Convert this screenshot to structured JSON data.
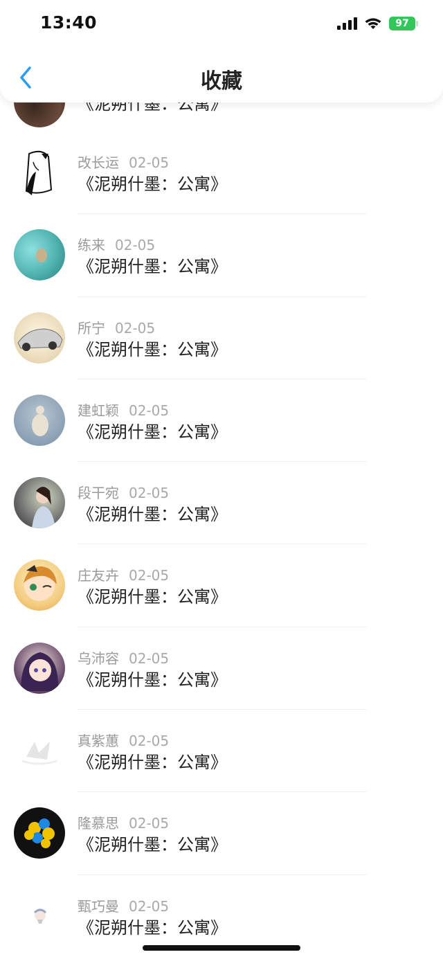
{
  "status": {
    "time": "13:40",
    "battery": "97"
  },
  "header": {
    "title": "收藏"
  },
  "items": [
    {
      "name": "",
      "date": "",
      "book": "《泥朔什墨：公寓》",
      "avatar_color": "#6b4a3a"
    },
    {
      "name": "改长运",
      "date": "02-05",
      "book": "《泥朔什墨：公寓》",
      "avatar_color": "#ffffff"
    },
    {
      "name": "练来",
      "date": "02-05",
      "book": "《泥朔什墨：公寓》",
      "avatar_color": "#4fb3b0"
    },
    {
      "name": "所宁",
      "date": "02-05",
      "book": "《泥朔什墨：公寓》",
      "avatar_color": "#e8d8b5"
    },
    {
      "name": "建虹颖",
      "date": "02-05",
      "book": "《泥朔什墨：公寓》",
      "avatar_color": "#8aa0b3"
    },
    {
      "name": "段干宛",
      "date": "02-05",
      "book": "《泥朔什墨：公寓》",
      "avatar_color": "#6d6d6d"
    },
    {
      "name": "庄友卉",
      "date": "02-05",
      "book": "《泥朔什墨：公寓》",
      "avatar_color": "#f3cb7e"
    },
    {
      "name": "乌沛容",
      "date": "02-05",
      "book": "《泥朔什墨：公寓》",
      "avatar_color": "#6b4c6e"
    },
    {
      "name": "真紫蕙",
      "date": "02-05",
      "book": "《泥朔什墨：公寓》",
      "avatar_color": "#f3f3f3"
    },
    {
      "name": "隆慕思",
      "date": "02-05",
      "book": "《泥朔什墨：公寓》",
      "avatar_color": "#1d2a2f"
    },
    {
      "name": "甄巧曼",
      "date": "02-05",
      "book": "《泥朔什墨：公寓》",
      "avatar_color": "#ffffff"
    }
  ]
}
